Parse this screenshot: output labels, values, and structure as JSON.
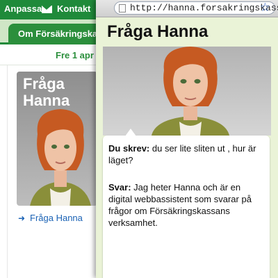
{
  "site": {
    "topbar": {
      "anpassa": "Anpassa",
      "kontakt": "Kontakt"
    },
    "nav_tab": "Om Försäkringskassan",
    "date": "Fre 1 apr",
    "card_title_line1": "Fråga",
    "card_title_line2": "Hanna",
    "card_link_arrow": "➜",
    "card_link": "Fråga Hanna"
  },
  "popup": {
    "url": "http://hanna.forsakringskassan.se",
    "title": "Fråga Hanna",
    "question_label": "Du skrev:",
    "question_text": "du ser lite sliten ut , hur är läget?",
    "answer_label": "Svar:",
    "answer_text": "Jag heter Hanna och är en digital webbassistent som svarar på frågor om Försäkringskassans verksamhet."
  },
  "colors": {
    "brand_green": "#1f8a3a",
    "link_blue": "#1a62b5",
    "popup_bg": "#eaf3d7"
  },
  "icons": [
    "mail-icon",
    "page-icon",
    "bookmark-star-icon",
    "arrow-right-icon"
  ]
}
